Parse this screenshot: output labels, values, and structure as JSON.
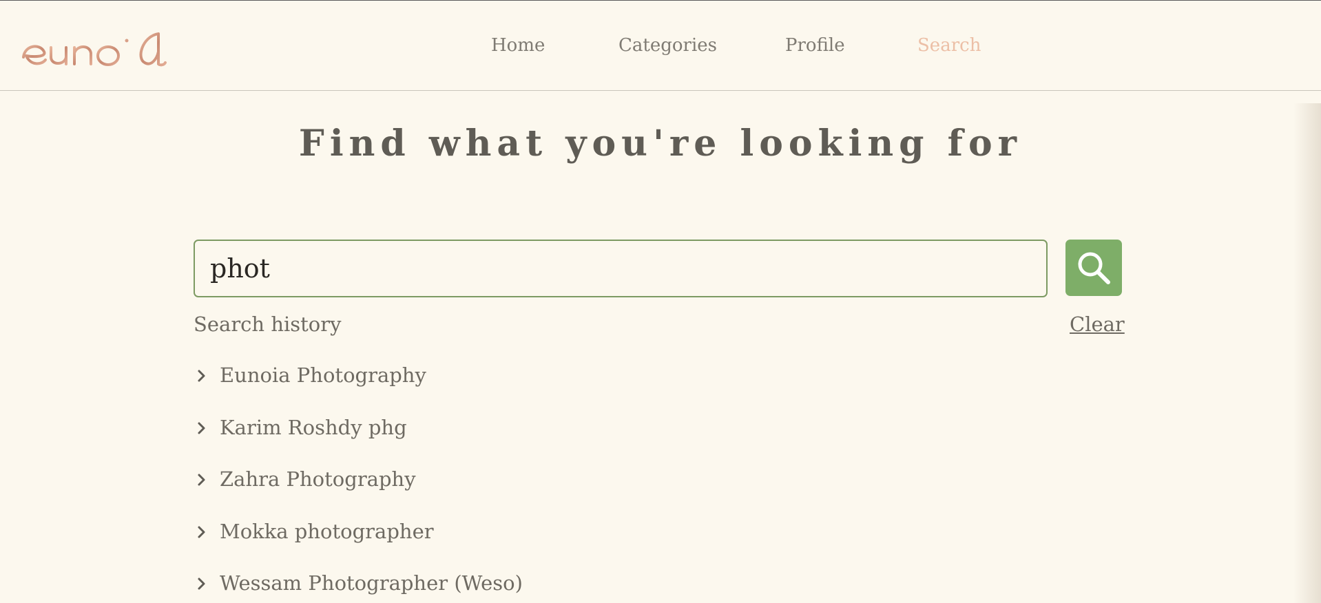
{
  "app": {
    "logo_text": "eunoia",
    "brand_color": "#d9a088"
  },
  "nav": {
    "items": [
      {
        "label": "Home",
        "active": false
      },
      {
        "label": "Categories",
        "active": false
      },
      {
        "label": "Profile",
        "active": false
      },
      {
        "label": "Search",
        "active": true
      }
    ],
    "active_color": "#ecbfa6"
  },
  "main": {
    "title": "Find what you're looking for",
    "search": {
      "value": "phot",
      "placeholder": "",
      "button_icon": "search-icon",
      "accent_color": "#7eae68"
    },
    "history": {
      "label": "Search history",
      "clear_label": "Clear",
      "items": [
        {
          "text": "Eunoia Photography",
          "icon": "chevron-right-icon"
        },
        {
          "text": "Karim Roshdy phg",
          "icon": "chevron-right-icon"
        },
        {
          "text": "Zahra Photography",
          "icon": "chevron-right-icon"
        },
        {
          "text": "Mokka photographer",
          "icon": "chevron-right-icon"
        },
        {
          "text": "Wessam Photographer (Weso)",
          "icon": "chevron-right-icon"
        }
      ]
    }
  }
}
